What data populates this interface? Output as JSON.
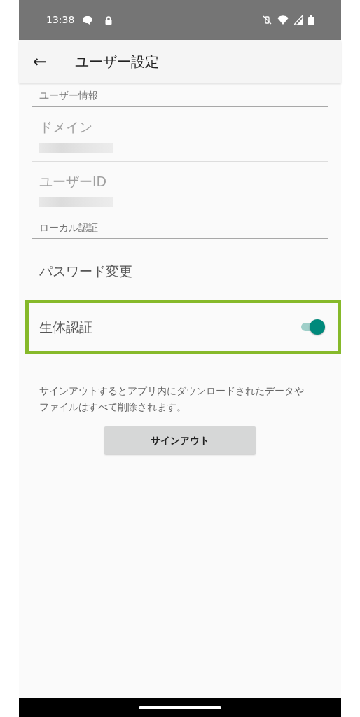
{
  "status_bar": {
    "time": "13:38"
  },
  "app_bar": {
    "back": "←",
    "title": "ユーザー設定"
  },
  "sections": [
    {
      "header": "ユーザー情報",
      "items": [
        {
          "kind": "info",
          "label": "ドメイン",
          "disabled": true,
          "value_redacted": true,
          "divider": true
        },
        {
          "kind": "info",
          "label": "ユーザーID",
          "disabled": true,
          "value_redacted": true,
          "divider": false
        }
      ]
    },
    {
      "header": "ローカル認証",
      "items": [
        {
          "kind": "action",
          "label": "パスワード変更",
          "disabled": false,
          "highlighted": false
        },
        {
          "kind": "switch",
          "label": "生体認証",
          "disabled": false,
          "on": true,
          "highlighted": true
        }
      ]
    }
  ],
  "note": "サインアウトするとアプリ内にダウンロードされたデータやファイルはすべて削除されます。",
  "sign_out_button": "サインアウト"
}
